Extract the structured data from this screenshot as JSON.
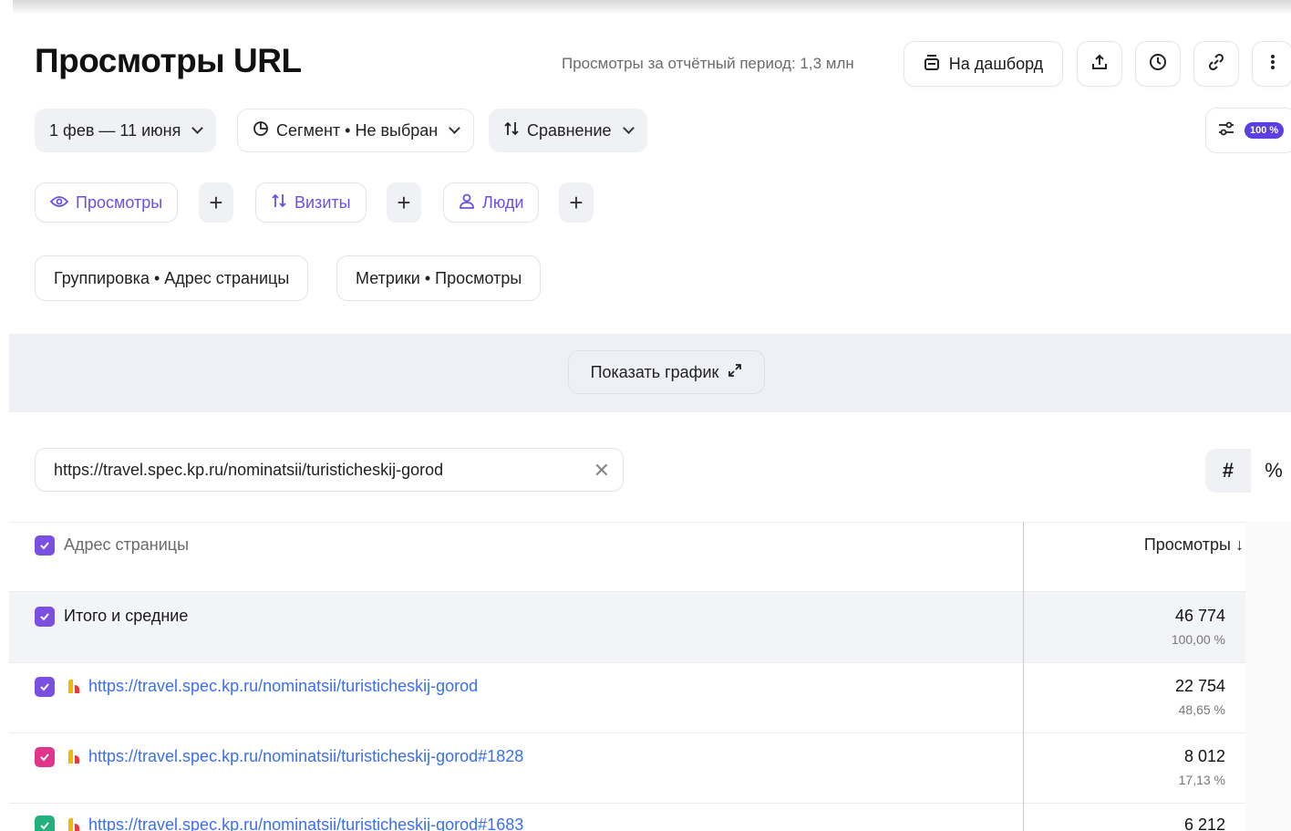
{
  "header": {
    "title": "Просмотры URL",
    "period_info": "Просмотры за отчётный период: 1,3 млн",
    "dashboard_label": "На дашборд"
  },
  "filters": {
    "date_range": "1 фев — 11 июня",
    "segment": "Сегмент • Не выбран",
    "comparison": "Сравнение",
    "sampling_badge": "100 %"
  },
  "metrics": [
    {
      "label": "Просмотры",
      "icon": "eye-icon"
    },
    {
      "label": "Визиты",
      "icon": "visits-icon"
    },
    {
      "label": "Люди",
      "icon": "person-icon"
    }
  ],
  "grouping": {
    "group_label": "Группировка • Адрес страницы",
    "metrics_label": "Метрики • Просмотры"
  },
  "chart_toggle": {
    "label": "Показать график"
  },
  "search": {
    "value": "https://travel.spec.kp.ru/nominatsii/turisticheskij-gorod"
  },
  "view_toggle": {
    "absolute": "#",
    "percent": "%"
  },
  "table": {
    "col_dimension": "Адрес страницы",
    "col_metric": "Просмотры ↓",
    "total": {
      "label": "Итого и средние",
      "value": "46 774",
      "pct": "100,00 %"
    },
    "rows": [
      {
        "url": "https://travel.spec.kp.ru/nominatsii/turisticheskij-gorod",
        "value": "22 754",
        "pct": "48,65 %",
        "color": "#7b4fe0"
      },
      {
        "url": "https://travel.spec.kp.ru/nominatsii/turisticheskij-gorod#1828",
        "value": "8 012",
        "pct": "17,13 %",
        "color": "#e0358a"
      },
      {
        "url": "https://travel.spec.kp.ru/nominatsii/turisticheskij-gorod#1683",
        "value": "6 212",
        "pct": "",
        "color": "#22b07d"
      }
    ]
  },
  "colors": {
    "accent": "#6a4fe8",
    "link": "#3b6ff0",
    "band": "#eef0f6"
  }
}
